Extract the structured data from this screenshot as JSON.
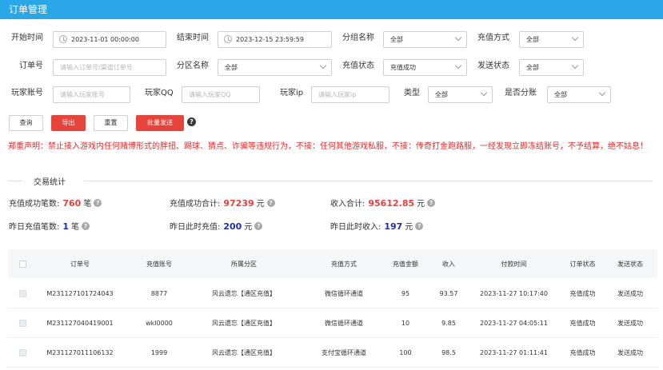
{
  "window": {
    "title": "订单管理"
  },
  "filters": {
    "start_time": {
      "label": "开始时间",
      "value": "2023-11-01 00:00:00"
    },
    "end_time": {
      "label": "结束时间",
      "value": "2023-12-15 23:59:59"
    },
    "group_name": {
      "label": "分组名称",
      "value": "全部"
    },
    "pay_method": {
      "label": "充值方式",
      "value": "全部"
    },
    "order_no": {
      "label": "订单号",
      "placeholder": "请输入订单号/渠道订单号"
    },
    "zone_name": {
      "label": "分区名称",
      "value": "全部"
    },
    "pay_status": {
      "label": "充值状态",
      "value": "充值成功"
    },
    "send_status": {
      "label": "发送状态",
      "value": "全部"
    },
    "player_account": {
      "label": "玩家账号",
      "placeholder": "请输入玩家账号"
    },
    "player_qq": {
      "label": "玩家QQ",
      "placeholder": "请输入玩家QQ"
    },
    "player_ip": {
      "label": "玩家ip",
      "placeholder": "请输入玩家ip"
    },
    "type": {
      "label": "类型",
      "value": "全部"
    },
    "is_split": {
      "label": "是否分账",
      "value": "全部"
    }
  },
  "actions": {
    "query": "查询",
    "export": "导出",
    "reset": "重置",
    "batch_send": "批量发送",
    "help": "?"
  },
  "notice": "郑重声明：禁止接入游戏内任何赌博形式的胖扭、踢球、猜点、诈骗等违规行为，不接：任何其他游戏私服，不接：传奇打金跑路服，一经发现立即冻结账号，不予结算，绝不姑息！",
  "stats_section": {
    "title": "交易统计",
    "items": [
      {
        "label": "充值成功笔数:",
        "value": "760",
        "unit": "笔",
        "color": "red"
      },
      {
        "label": "充值成功合计:",
        "value": "97239",
        "unit": "元",
        "color": "red"
      },
      {
        "label": "收入合计:",
        "value": "95612.85",
        "unit": "元",
        "color": "red"
      },
      {
        "label": "昨日充值笔数:",
        "value": "1",
        "unit": "笔",
        "color": "blue"
      },
      {
        "label": "昨日此时充值:",
        "value": "200",
        "unit": "元",
        "color": "blue"
      },
      {
        "label": "昨日此时收入:",
        "value": "197",
        "unit": "元",
        "color": "blue"
      }
    ]
  },
  "table": {
    "columns": [
      "订单号",
      "充值账号",
      "所属分区",
      "充值方式",
      "充值金额",
      "收入",
      "付款时间",
      "订单状态",
      "发送状态"
    ],
    "rows": [
      [
        "M231127101724043",
        "8877",
        "风云遗忘【通区充值】",
        "微信循环通道",
        "95",
        "93.57",
        "2023-11-27 10:17:40",
        "充值成功",
        "发送成功"
      ],
      [
        "M231127040419001",
        "wkl0000",
        "风云遗忘【通区充值】",
        "微信循环通道",
        "10",
        "9.85",
        "2023-11-27 04:05:11",
        "充值成功",
        "发送成功"
      ],
      [
        "M231127011106132",
        "1999",
        "风云遗忘【通区充值】",
        "支付宝循环通道",
        "100",
        "98.5",
        "2023-11-27 01:11:41",
        "充值成功",
        "发送成功"
      ]
    ]
  },
  "colors": {
    "titlebar": "#2aa7e8",
    "danger": "#e6443b",
    "stat_red": "#e54040",
    "stat_blue": "#1f2fa8"
  }
}
